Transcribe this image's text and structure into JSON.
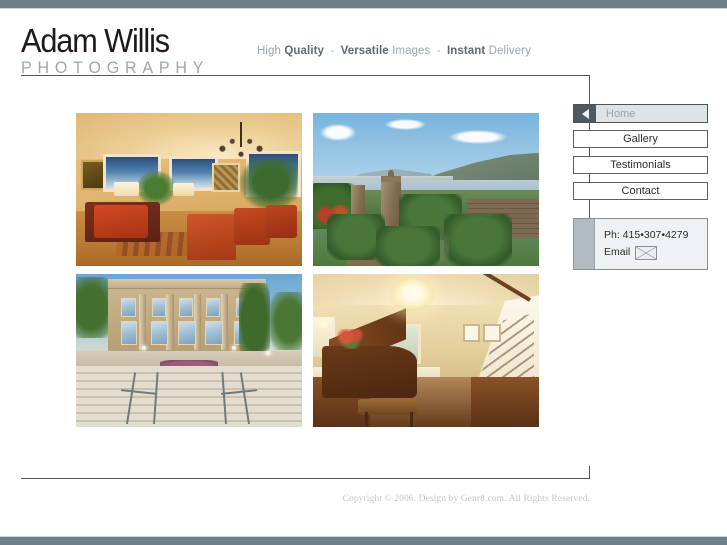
{
  "site": {
    "logo_name": "Adam Willis",
    "logo_sub": "PHOTOGRAPHY",
    "tagline": {
      "w1_light": "High",
      "w1_bold": "Quality",
      "sep1": "-",
      "w2_bold": "Versatile",
      "w2_light": "Images",
      "sep2": "-",
      "w3_bold": "Instant",
      "w3_light": "Delivery"
    },
    "accent_slate": "#6d7f89",
    "accent_dark": "#4e5a61",
    "rule_color": "#55555a"
  },
  "nav": {
    "home": {
      "label": "Home",
      "active": true,
      "arrow_icon": "left-triangle-icon"
    },
    "items": [
      {
        "label": "Gallery"
      },
      {
        "label": "Testimonials"
      },
      {
        "label": "Contact"
      }
    ]
  },
  "contact": {
    "phone_label": "Ph: 415•307•4279",
    "email_label": "Email",
    "email_icon": "envelope-icon"
  },
  "gallery": {
    "photos": [
      {
        "alt": "Warm-lit living and dining room with red chairs and chandelier"
      },
      {
        "alt": "Hillside garden with stone gate pillars overlooking the bay"
      },
      {
        "alt": "Neoclassical mansion with columns and wide stone staircase"
      },
      {
        "alt": "Elegant foyer with grand piano, chandelier and white staircase"
      }
    ]
  },
  "footer": {
    "copyright": "Copyright © 2006. Design by Genr8.com. All Rights Reserved."
  }
}
